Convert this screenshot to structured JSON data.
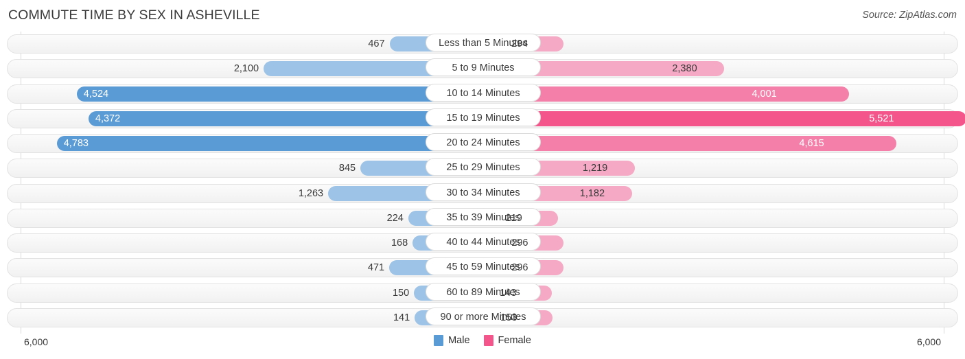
{
  "header": {
    "title": "COMMUTE TIME BY SEX IN ASHEVILLE",
    "source": "Source: ZipAtlas.com"
  },
  "axis": {
    "left_tick": "6,000",
    "right_tick": "6,000",
    "max": 6000
  },
  "legend": {
    "items": [
      {
        "label": "Male",
        "color": "#5B9BD5"
      },
      {
        "label": "Female",
        "color": "#F4568B"
      }
    ]
  },
  "colors": {
    "male_light": "#9DC3E6",
    "male_dark": "#5B9BD5",
    "female_light": "#F5A9C4",
    "female_mid": "#F47FA8",
    "female_dark": "#F4568B",
    "track_border": "#E2E2E2",
    "axis_line": "#D8D8D8",
    "text": "#3A3A3A"
  },
  "chart_data": {
    "type": "bar",
    "subtype": "diverging-bidirectional",
    "title": "COMMUTE TIME BY SEX IN ASHEVILLE",
    "xlabel": "",
    "ylabel": "",
    "xlim": [
      6000,
      6000
    ],
    "grid": false,
    "legend_position": "bottom-center",
    "categories": [
      "Less than 5 Minutes",
      "5 to 9 Minutes",
      "10 to 14 Minutes",
      "15 to 19 Minutes",
      "20 to 24 Minutes",
      "25 to 29 Minutes",
      "30 to 34 Minutes",
      "35 to 39 Minutes",
      "40 to 44 Minutes",
      "45 to 59 Minutes",
      "60 to 89 Minutes",
      "90 or more Minutes"
    ],
    "series": [
      {
        "name": "Male",
        "direction": "left",
        "values": [
          467,
          2100,
          4524,
          4372,
          4783,
          845,
          1263,
          224,
          168,
          471,
          150,
          141
        ],
        "labels": [
          "467",
          "2,100",
          "4,524",
          "4,372",
          "4,783",
          "845",
          "1,263",
          "224",
          "168",
          "471",
          "150",
          "141"
        ]
      },
      {
        "name": "Female",
        "direction": "right",
        "values": [
          294,
          2380,
          4001,
          5521,
          4615,
          1219,
          1182,
          219,
          296,
          296,
          143,
          153
        ],
        "labels": [
          "294",
          "2,380",
          "4,001",
          "5,521",
          "4,615",
          "1,219",
          "1,182",
          "219",
          "296",
          "296",
          "143",
          "153"
        ]
      }
    ]
  }
}
